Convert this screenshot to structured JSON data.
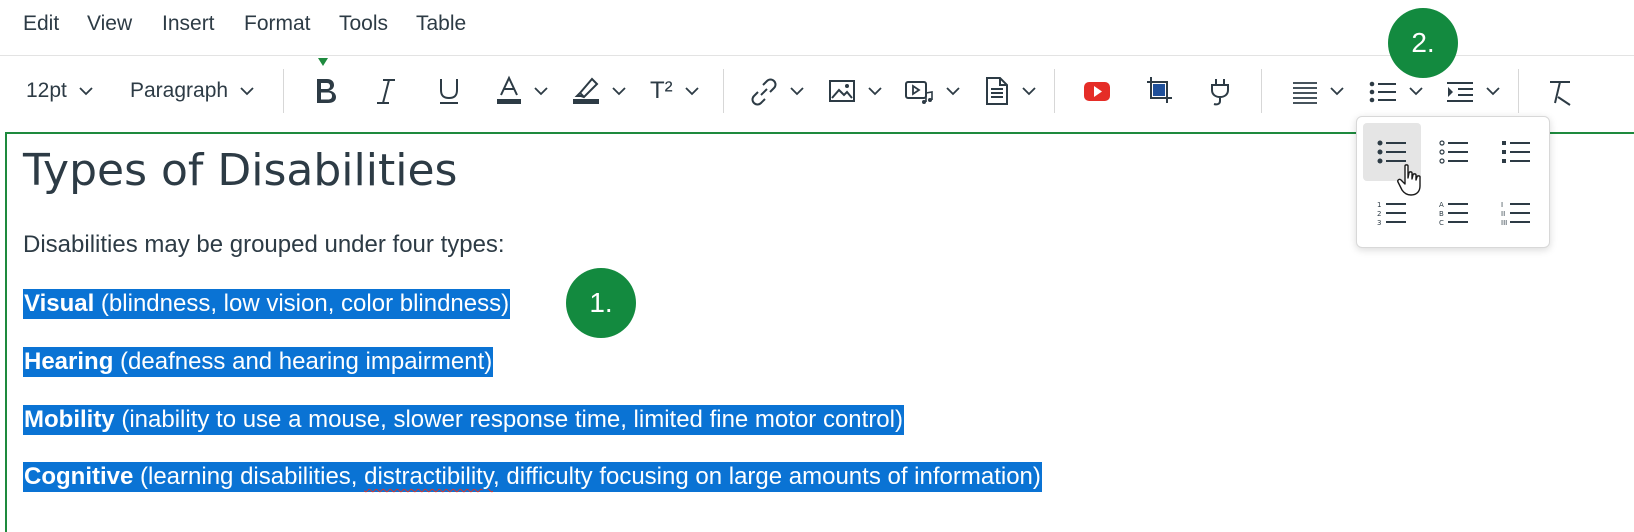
{
  "menubar": {
    "items": [
      "Edit",
      "View",
      "Insert",
      "Format",
      "Tools",
      "Table"
    ]
  },
  "toolbar": {
    "font_size": "12pt",
    "block_format": "Paragraph",
    "superscript_label": "T²"
  },
  "document": {
    "title": "Types of Disabilities",
    "intro": "Disabilities may be grouped under four types:",
    "items": [
      {
        "bold": "Visual",
        "rest": " (blindness, low vision, color blindness)"
      },
      {
        "bold": "Hearing",
        "rest": " (deafness and hearing impairment)"
      },
      {
        "bold": "Mobility",
        "rest": " (inability to use a mouse, slower response time, limited fine motor control)"
      },
      {
        "bold": "Cognitive",
        "rest_before": " (learning disabilities, ",
        "misspelled": "distractibility",
        "rest_after": ", difficulty focusing on large amounts of information)"
      }
    ]
  },
  "badges": {
    "step1": "1.",
    "step2": "2."
  },
  "list_popup": {
    "options": [
      "bullet-default-icon",
      "bullet-circle-icon",
      "bullet-square-icon",
      "numbered-default-icon",
      "numbered-alpha-icon",
      "numbered-roman-icon"
    ]
  },
  "colors": {
    "selection": "#0a73d4",
    "badge": "#138a3f",
    "editor_focus": "#1e8a3e",
    "youtube": "#e52d27"
  }
}
